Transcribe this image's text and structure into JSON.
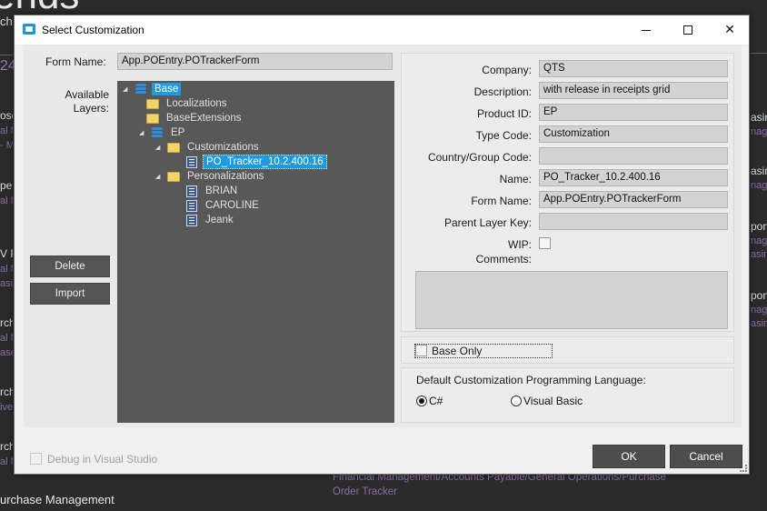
{
  "background": {
    "big_title": "ends",
    "subtitle": "ch",
    "number": "24",
    "left_items": [
      {
        "label": "ose",
        "sub1": "al M",
        "sub2": "- M"
      },
      {
        "label": "pe",
        "sub1": "al M",
        "sub2": ""
      },
      {
        "label": "V P",
        "sub1": "al M",
        "sub2": "asin"
      },
      {
        "label": "rch",
        "sub1": "al M",
        "sub2": "ase"
      },
      {
        "label": "rch",
        "sub1": "ive",
        "sub2": ""
      },
      {
        "label": "rch",
        "sub1": "al M",
        "sub2": ""
      }
    ],
    "right_items": [
      {
        "label": "asin",
        "sub1": "nag",
        "sub2": ""
      },
      {
        "label": "asin",
        "sub1": "nag",
        "sub2": ""
      },
      {
        "label": "pon",
        "sub1": "nag",
        "sub2": "asin"
      },
      {
        "label": "pon",
        "sub1": "nag",
        "sub2": "asin"
      }
    ],
    "breadcrumb": "Financial Management/Accounts Payable/General Operations/Purchase Order Tracker",
    "bottom_label": "urchase Management"
  },
  "dialog": {
    "title": "Select Customization",
    "controls": {
      "minimize": "minimize",
      "maximize": "maximize",
      "close": "✕"
    }
  },
  "form_name_label": "Form Name:",
  "form_name_value": "App.POEntry.POTrackerForm",
  "available_layers_label": "Available\nLayers:",
  "tree": [
    {
      "label": "Base",
      "icon": "database-icon",
      "level": 0,
      "expanded": true,
      "selected": true
    },
    {
      "label": "Localizations",
      "icon": "folder-icon",
      "level": 1
    },
    {
      "label": "BaseExtensions",
      "icon": "folder-icon",
      "level": 1
    },
    {
      "label": "EP",
      "icon": "database-icon",
      "level": 1,
      "expanded": true
    },
    {
      "label": "Customizations",
      "icon": "folder-icon",
      "level": 2,
      "expanded": true
    },
    {
      "label": "PO_Tracker_10.2.400.16",
      "icon": "document-icon",
      "level": 3,
      "highlighted": true
    },
    {
      "label": "Personalizations",
      "icon": "folder-icon",
      "level": 2,
      "expanded": true
    },
    {
      "label": "BRIAN",
      "icon": "document-icon",
      "level": 3
    },
    {
      "label": "CAROLINE",
      "icon": "document-icon",
      "level": 3
    },
    {
      "label": "Jeank",
      "icon": "document-icon",
      "level": 3
    }
  ],
  "buttons": {
    "delete": "Delete",
    "import": "Import",
    "ok": "OK",
    "cancel": "Cancel"
  },
  "details": {
    "company": {
      "label": "Company:",
      "value": "QTS"
    },
    "description": {
      "label": "Description:",
      "value": "with release in receipts grid"
    },
    "product_id": {
      "label": "Product ID:",
      "value": "EP"
    },
    "type_code": {
      "label": "Type Code:",
      "value": "Customization"
    },
    "country_group_code": {
      "label": "Country/Group Code:",
      "value": ""
    },
    "name": {
      "label": "Name:",
      "value": "PO_Tracker_10.2.400.16"
    },
    "form_name": {
      "label": "Form Name:",
      "value": "App.POEntry.POTrackerForm"
    },
    "parent_layer_key": {
      "label": "Parent Layer Key:",
      "value": ""
    },
    "wip": {
      "label": "WIP:",
      "checked": false
    },
    "comments": {
      "label": "Comments:",
      "value": ""
    }
  },
  "base_only": {
    "label": "Base Only",
    "checked": false
  },
  "language": {
    "label": "Default Customization Programming Language:",
    "options": [
      {
        "label": "C#",
        "selected": true
      },
      {
        "label": "Visual Basic",
        "selected": false
      }
    ]
  },
  "debug": {
    "label": "Debug in Visual Studio",
    "checked": false,
    "enabled": false
  }
}
